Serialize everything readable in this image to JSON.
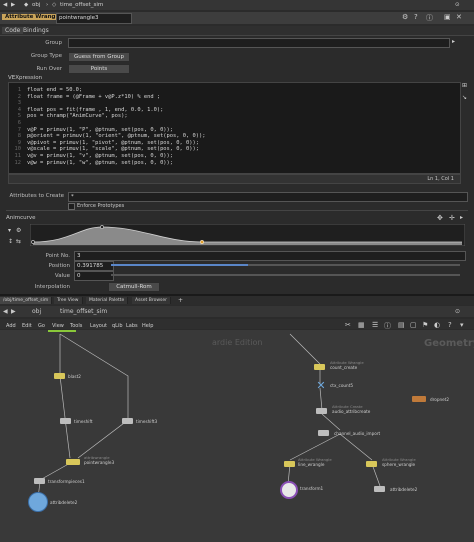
{
  "path": {
    "crumb1": "obj",
    "crumb2": "time_offset_sim"
  },
  "node_header": {
    "type": "Attribute Wrangle",
    "name": "pointwrangle3"
  },
  "param_tabs": [
    "Code",
    "Bindings"
  ],
  "params": {
    "group_label": "Group",
    "group_value": "",
    "group_type_label": "Group Type",
    "group_type_value": "Guess from Group",
    "run_over_label": "Run Over",
    "run_over_value": "Points",
    "vex_label": "VEXpression"
  },
  "code_lines": [
    {
      "n": "1",
      "t": "float end = 50.0;"
    },
    {
      "n": "2",
      "t": "float frame = (@Frame + v@P.z*10) % end ;"
    },
    {
      "n": "3",
      "t": ""
    },
    {
      "n": "4",
      "t": "float pos = fit(frame , 1, end, 0.0, 1.0);"
    },
    {
      "n": "5",
      "t": "pos = chramp(\"AnimCurve\", pos);"
    },
    {
      "n": "6",
      "t": ""
    },
    {
      "n": "7",
      "t": "v@P = primuv(1, \"P\", @ptnum, set(pos, 0, 0));"
    },
    {
      "n": "8",
      "t": "p@orient = primuv(1, \"orient\", @ptnum, set(pos, 0, 0));"
    },
    {
      "n": "9",
      "t": "v@pivot = primuv(1, \"pivot\", @ptnum, set(pos, 0, 0));"
    },
    {
      "n": "10",
      "t": "v@scale = primuv(1, \"scale\", @ptnum, set(pos, 0, 0));"
    },
    {
      "n": "11",
      "t": "v@v = primuv(1, \"v\", @ptnum, set(pos, 0, 0));"
    },
    {
      "n": "12",
      "t": "v@w = primuv(1, \"w\", @ptnum, set(pos, 0, 0));"
    }
  ],
  "status": "Ln 1, Col 1",
  "attrs_label": "Attributes to Create",
  "attrs_value": "*",
  "enforce_label": "Enforce Prototypes",
  "ramp": {
    "label": "Animcurve",
    "point_no_label": "Point No.",
    "point_no": "3",
    "position_label": "Position",
    "position": "0.391785",
    "position_fraction": 0.391785,
    "value_label": "Value",
    "value": "0",
    "interp_label": "Interpolation",
    "interp_value": "Catmull-Rom"
  },
  "net_tabs": [
    "/obj/time_offset_sim",
    "Tree View",
    "Material Palette",
    "Asset Browser"
  ],
  "net_path": {
    "crumb1": "obj",
    "crumb2": "time_offset_sim"
  },
  "menu": [
    "Add",
    "Edit",
    "Go",
    "View",
    "Tools",
    "Layout",
    "qLib",
    "Labs",
    "Help"
  ],
  "watermark_left": "ardie Edition",
  "watermark_right": "Geometry",
  "nodes": [
    {
      "label": "blast2",
      "sub": ""
    },
    {
      "label": "timeshift",
      "sub": ""
    },
    {
      "label": "timeshift3",
      "sub": ""
    },
    {
      "label": "pointwrangle3",
      "sub": "attribwrangle"
    },
    {
      "label": "transformpieces1",
      "sub": ""
    },
    {
      "label": "attribdelete2",
      "sub": ""
    },
    {
      "label": "count_create",
      "sub": "Attribute Wrangle"
    },
    {
      "label": "ctx_count5",
      "sub": ""
    },
    {
      "label": "audio_attribcreate",
      "sub": "Attribute Create"
    },
    {
      "label": "channel_audio_import",
      "sub": ""
    },
    {
      "label": "line_wrangle",
      "sub": "Attribute Wrangle"
    },
    {
      "label": "sphere_wrangle",
      "sub": "Attribute Wrangle"
    },
    {
      "label": "transform1",
      "sub": ""
    },
    {
      "label": "attribdelete2",
      "sub": ""
    },
    {
      "label": "dropnet2",
      "sub": ""
    }
  ],
  "colors": {
    "accent": "#c9a45a",
    "node_yellow": "#d8c75a",
    "node_gray": "#bdbdbd",
    "node_blue": "#6fa8dc",
    "node_purple": "#8a4fb5",
    "node_orange": "#c07a3a"
  }
}
